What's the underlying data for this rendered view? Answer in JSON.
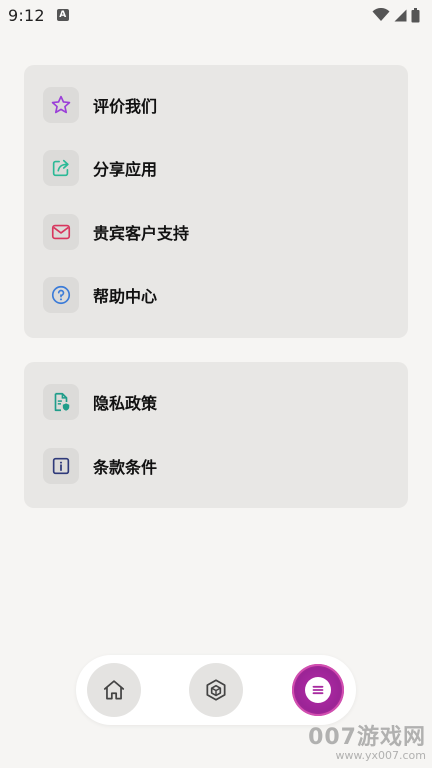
{
  "status_bar": {
    "time": "9:12",
    "notification_icon_letter": "A",
    "icons": [
      "wifi-icon",
      "signal-icon",
      "battery-icon"
    ]
  },
  "main_menu": {
    "items": [
      {
        "label": "评价我们",
        "icon": "star-icon",
        "icon_color": "#9b3fd8"
      },
      {
        "label": "分享应用",
        "icon": "share-icon",
        "icon_color": "#2bb996"
      },
      {
        "label": "贵宾客户支持",
        "icon": "mail-icon",
        "icon_color": "#d8365e"
      },
      {
        "label": "帮助中心",
        "icon": "help-icon",
        "icon_color": "#3b7bd8"
      }
    ]
  },
  "legal_menu": {
    "items": [
      {
        "label": "隐私政策",
        "icon": "privacy-document-icon",
        "icon_color": "#1f9d8a"
      },
      {
        "label": "条款条件",
        "icon": "info-icon",
        "icon_color": "#2f3a7a"
      }
    ]
  },
  "bottom_nav": {
    "items": [
      {
        "name": "home",
        "icon": "home-icon",
        "active": false
      },
      {
        "name": "box",
        "icon": "cube-icon",
        "active": false
      },
      {
        "name": "menu",
        "icon": "menu-icon",
        "active": true
      }
    ],
    "active_color": "#a82aa0"
  },
  "watermark": {
    "main": "007游戏网",
    "sub": "www.yx007.com"
  }
}
